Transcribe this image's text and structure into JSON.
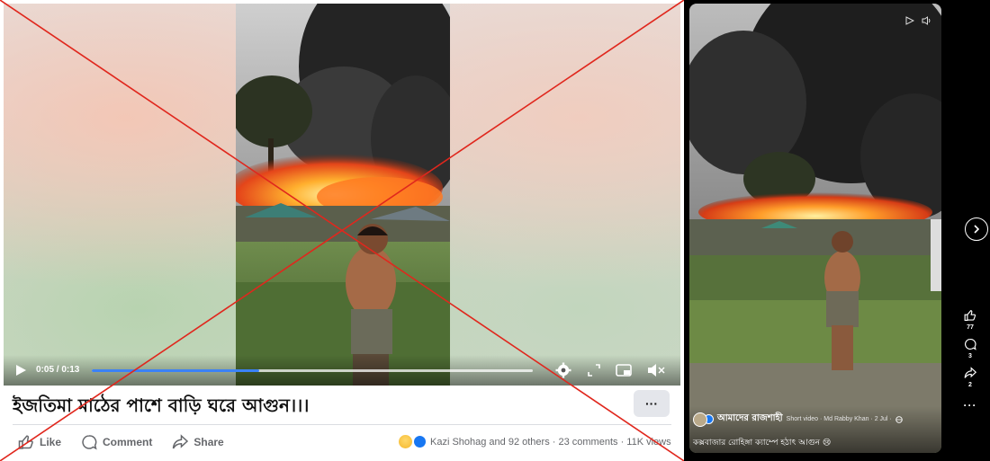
{
  "player": {
    "time_label": "0:05 / 0:13",
    "progress_fraction": 0.38
  },
  "post": {
    "title": "ইজতিমা মাঠের পাশে বাড়ি ঘরে আগুন।।।",
    "more_label": "···",
    "actions": {
      "like": "Like",
      "comment": "Comment",
      "share": "Share"
    },
    "reactions_summary": "Kazi Shohag and 92 others · 23 comments · 11K views"
  },
  "reel": {
    "page_name": "আমাদের রাজশাহী",
    "meta": "Short video · Md Rabby Khan · 2 Jul ·",
    "caption": "কক্সবাজার রোহিঙ্গা ক্যাম্পে হঠাৎ আগুন 😢",
    "counts": {
      "likes": "77",
      "comments": "3",
      "shares": "2"
    }
  },
  "overlay": {
    "cross_color": "#e0271d"
  },
  "icons": [
    "play-icon",
    "settings-icon",
    "expand-icon",
    "pip-icon",
    "mute-icon",
    "like-icon",
    "comment-icon",
    "share-icon",
    "next-icon",
    "more-icon"
  ],
  "colors": {
    "progress": "#3b82f6",
    "text_muted": "#65676b",
    "button_bg": "#e4e6eb"
  }
}
